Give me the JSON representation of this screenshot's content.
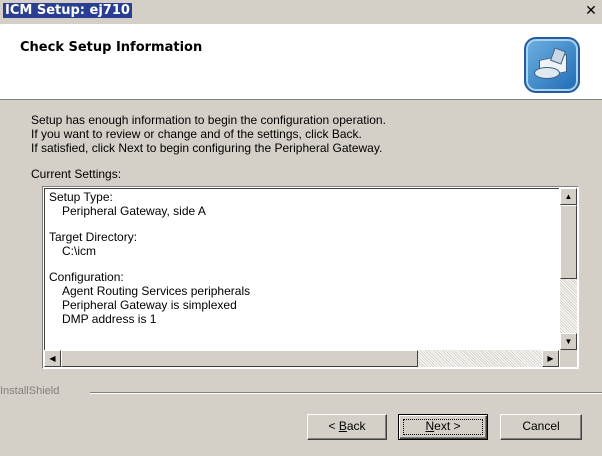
{
  "window": {
    "title": "ICM Setup: ej710",
    "close_glyph": "✕"
  },
  "header": {
    "title": "Check Setup Information",
    "icon": "installer-icon"
  },
  "intro": {
    "line1": "Setup has enough information to begin the configuration operation.",
    "line2": "If you want to review or change and of the settings, click Back.",
    "line3": "If satisfied, click Next to begin configuring the Peripheral Gateway."
  },
  "current_settings": {
    "label": "Current Settings:",
    "setup_type_label": "Setup Type:",
    "setup_type_value": "Peripheral Gateway, side A",
    "target_dir_label": "Target Directory:",
    "target_dir_value": "C:\\icm",
    "config_label": "Configuration:",
    "config_lines": [
      "Agent Routing Services peripherals",
      "Peripheral Gateway is simplexed",
      "DMP address is 1"
    ]
  },
  "footer": {
    "brand": "InstallShield"
  },
  "buttons": {
    "back_prefix": "< ",
    "back_key": "B",
    "back_rest": "ack",
    "next_key": "N",
    "next_rest": "ext >",
    "cancel": "Cancel"
  },
  "colors": {
    "titlebar_highlight": "#2a3f93",
    "dialog_bg": "#d4d0c8"
  }
}
